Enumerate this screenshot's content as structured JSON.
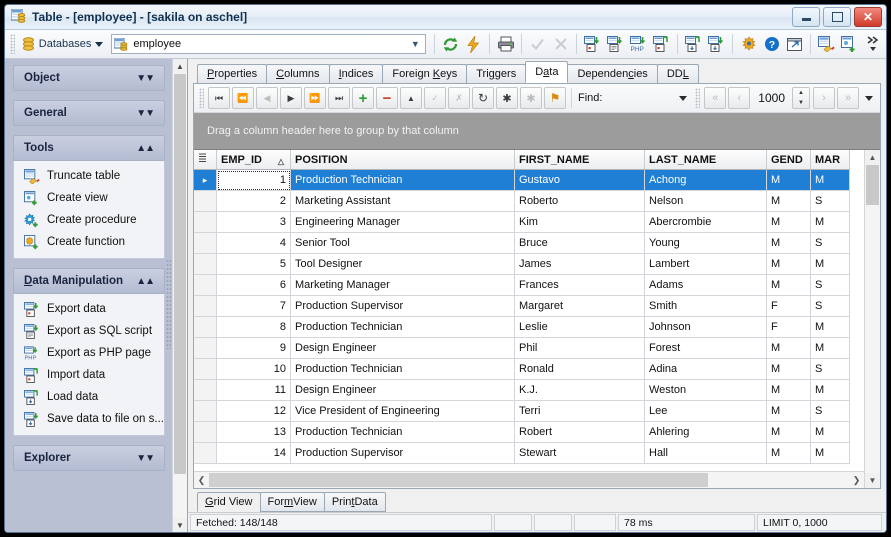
{
  "window": {
    "title": "Table - [employee] - [sakila on aschel]",
    "icon": "table-icon",
    "minimize_label": "Minimize",
    "maximize_label": "Maximize",
    "close_label": "✕"
  },
  "toolbar": {
    "databases_label": "Databases",
    "object_combo_value": "employee",
    "buttons": [
      {
        "name": "refresh-button",
        "icon": "refresh-icon"
      },
      {
        "name": "execute-button",
        "icon": "lightning-icon"
      },
      {
        "name": "print-button",
        "icon": "printer-icon"
      },
      {
        "name": "commit-button",
        "icon": "check-icon"
      },
      {
        "name": "rollback-button",
        "icon": "cross-icon"
      },
      {
        "name": "export-data-button",
        "icon": "export-data-icon"
      },
      {
        "name": "export-sql-button",
        "icon": "export-sql-icon"
      },
      {
        "name": "export-php-button",
        "icon": "export-php-icon"
      },
      {
        "name": "import-data-button",
        "icon": "import-data-icon"
      },
      {
        "name": "load-data-button",
        "icon": "load-data-icon"
      },
      {
        "name": "save-data-button",
        "icon": "save-data-icon"
      },
      {
        "name": "settings-button",
        "icon": "options-icon"
      },
      {
        "name": "help-button",
        "icon": "help-icon"
      },
      {
        "name": "open-external-button",
        "icon": "external-window-icon"
      },
      {
        "name": "truncate-table-button",
        "icon": "truncate-table-icon"
      },
      {
        "name": "create-view-button",
        "icon": "create-view-icon"
      },
      {
        "name": "overflow-button",
        "icon": "chevron-double-right-icon"
      }
    ]
  },
  "sidebar": {
    "sections": [
      {
        "title": "Object",
        "collapsed": true,
        "items": []
      },
      {
        "title": "General",
        "collapsed": true,
        "items": []
      },
      {
        "title": "Tools",
        "collapsed": false,
        "items": [
          {
            "label": "Truncate table",
            "icon": "truncate-table-icon"
          },
          {
            "label": "Create view",
            "icon": "create-view-icon"
          },
          {
            "label": "Create procedure",
            "icon": "create-procedure-icon"
          },
          {
            "label": "Create function",
            "icon": "create-function-icon"
          }
        ]
      },
      {
        "title": "Data Manipulation",
        "title_accel": "D",
        "collapsed": false,
        "items": [
          {
            "label": "Export data",
            "icon": "export-data-icon"
          },
          {
            "label": "Export as SQL script",
            "icon": "export-sql-icon"
          },
          {
            "label": "Export as PHP page",
            "icon": "export-php-icon"
          },
          {
            "label": "Import data",
            "icon": "import-data-icon"
          },
          {
            "label": "Load data",
            "icon": "load-data-icon"
          },
          {
            "label": "Save data to file on s...",
            "icon": "save-data-icon"
          }
        ]
      },
      {
        "title": "Explorer",
        "collapsed": true,
        "items": []
      }
    ]
  },
  "tabs": [
    {
      "label": "Properties",
      "accel": "P",
      "active": false
    },
    {
      "label": "Columns",
      "accel": "C",
      "active": false
    },
    {
      "label": "Indices",
      "accel": "I",
      "active": false
    },
    {
      "label": "Foreign Keys",
      "accel": "K",
      "active": false
    },
    {
      "label": "Triggers",
      "accel": "g",
      "active": false
    },
    {
      "label": "Data",
      "accel": "a",
      "active": true
    },
    {
      "label": "Dependencies",
      "accel": "c",
      "active": false
    },
    {
      "label": "DDL",
      "accel": "L",
      "active": false
    }
  ],
  "navbar": {
    "buttons": [
      {
        "name": "first-record-button",
        "icon": "first-icon",
        "glyph": "⏮",
        "disabled": false
      },
      {
        "name": "prior-page-button",
        "icon": "prior-page-icon",
        "glyph": "⏪",
        "disabled": true
      },
      {
        "name": "prior-record-button",
        "icon": "prior-icon",
        "glyph": "◀",
        "disabled": true
      },
      {
        "name": "next-record-button",
        "icon": "next-icon",
        "glyph": "▶",
        "disabled": false
      },
      {
        "name": "next-page-button",
        "icon": "next-page-icon",
        "glyph": "⏩",
        "disabled": false
      },
      {
        "name": "last-record-button",
        "icon": "last-icon",
        "glyph": "⏭",
        "disabled": false
      },
      {
        "name": "insert-record-button",
        "icon": "plus-icon",
        "glyph": "＋",
        "disabled": false,
        "color": "#2e9b34"
      },
      {
        "name": "delete-record-button",
        "icon": "minus-icon",
        "glyph": "−",
        "disabled": false,
        "color": "#cc3b28"
      },
      {
        "name": "edit-record-button",
        "icon": "triangle-up-icon",
        "glyph": "▲",
        "disabled": false
      },
      {
        "name": "post-edit-button",
        "icon": "check-icon",
        "glyph": "✓",
        "disabled": true
      },
      {
        "name": "cancel-edit-button",
        "icon": "cancel-icon",
        "glyph": "✗",
        "disabled": true
      },
      {
        "name": "refresh-data-button",
        "icon": "refresh-arrow-icon",
        "glyph": "↻",
        "disabled": false
      },
      {
        "name": "select-all-button",
        "icon": "asterisk-icon",
        "glyph": "✱",
        "disabled": false
      },
      {
        "name": "clear-selection-button",
        "icon": "asterisk-grey-icon",
        "glyph": "✱",
        "disabled": true
      },
      {
        "name": "filter-button",
        "icon": "filter-icon",
        "glyph": "⚑",
        "disabled": false,
        "color": "#d98a12"
      }
    ],
    "find_label": "Find:",
    "find_value": "",
    "record_limit": "1000",
    "pager_buttons": [
      {
        "name": "first-page-button",
        "icon": "double-left-icon",
        "glyph": "«",
        "disabled": true
      },
      {
        "name": "previous-page-button",
        "icon": "left-icon",
        "glyph": "‹",
        "disabled": true
      },
      {
        "name": "next-page-button2",
        "icon": "right-icon",
        "glyph": "›",
        "disabled": true
      },
      {
        "name": "last-page-button",
        "icon": "double-right-icon",
        "glyph": "»",
        "disabled": true
      }
    ]
  },
  "grid": {
    "group_panel_text": "Drag a column header here to group by that column",
    "columns": [
      {
        "key": "emp_id",
        "label": "EMP_ID",
        "sorted": true,
        "sort_dir": "asc",
        "align": "right"
      },
      {
        "key": "position",
        "label": "POSITION",
        "align": "left"
      },
      {
        "key": "first_name",
        "label": "FIRST_NAME",
        "align": "left"
      },
      {
        "key": "last_name",
        "label": "LAST_NAME",
        "align": "left"
      },
      {
        "key": "gender",
        "label": "GEND",
        "align": "left"
      },
      {
        "key": "marital",
        "label": "MAR",
        "align": "left"
      }
    ],
    "rows": [
      {
        "emp_id": "1",
        "position": "Production Technician",
        "first_name": "Gustavo",
        "last_name": "Achong",
        "gender": "M",
        "marital": "M",
        "selected": true
      },
      {
        "emp_id": "2",
        "position": "Marketing Assistant",
        "first_name": "Roberto",
        "last_name": "Nelson",
        "gender": "M",
        "marital": "S",
        "selected": false
      },
      {
        "emp_id": "3",
        "position": "Engineering Manager",
        "first_name": "Kim",
        "last_name": "Abercrombie",
        "gender": "M",
        "marital": "M",
        "selected": false
      },
      {
        "emp_id": "4",
        "position": "Senior Tool",
        "first_name": "Bruce",
        "last_name": "Young",
        "gender": "M",
        "marital": "S",
        "selected": false
      },
      {
        "emp_id": "5",
        "position": "Tool Designer",
        "first_name": "James",
        "last_name": "Lambert",
        "gender": "M",
        "marital": "M",
        "selected": false
      },
      {
        "emp_id": "6",
        "position": "Marketing Manager",
        "first_name": "Frances",
        "last_name": "Adams",
        "gender": "M",
        "marital": "S",
        "selected": false
      },
      {
        "emp_id": "7",
        "position": "Production Supervisor",
        "first_name": "Margaret",
        "last_name": "Smith",
        "gender": "F",
        "marital": "S",
        "selected": false
      },
      {
        "emp_id": "8",
        "position": "Production Technician",
        "first_name": "Leslie",
        "last_name": "Johnson",
        "gender": "F",
        "marital": "M",
        "selected": false
      },
      {
        "emp_id": "9",
        "position": "Design Engineer",
        "first_name": "Phil",
        "last_name": "Forest",
        "gender": "M",
        "marital": "M",
        "selected": false
      },
      {
        "emp_id": "10",
        "position": "Production Technician",
        "first_name": "Ronald",
        "last_name": "Adina",
        "gender": "M",
        "marital": "S",
        "selected": false
      },
      {
        "emp_id": "11",
        "position": "Design Engineer",
        "first_name": "K.J.",
        "last_name": "Weston",
        "gender": "M",
        "marital": "M",
        "selected": false
      },
      {
        "emp_id": "12",
        "position": "Vice President of Engineering",
        "first_name": "Terri",
        "last_name": "Lee",
        "gender": "M",
        "marital": "S",
        "selected": false
      },
      {
        "emp_id": "13",
        "position": "Production Technician",
        "first_name": "Robert",
        "last_name": "Ahlering",
        "gender": "M",
        "marital": "M",
        "selected": false
      },
      {
        "emp_id": "14",
        "position": "Production Supervisor",
        "first_name": "Stewart",
        "last_name": "Hall",
        "gender": "M",
        "marital": "M",
        "selected": false
      }
    ]
  },
  "view_tabs": [
    {
      "label": "Grid View",
      "accel": "G",
      "active": true
    },
    {
      "label": "Form View",
      "accel": "m",
      "active": false
    },
    {
      "label": "Print Data",
      "accel": "t",
      "active": false
    }
  ],
  "status": {
    "fetched": "Fetched: 148/148",
    "cell2": "",
    "cell3": "",
    "cell4": "",
    "elapsed": "78 ms",
    "limit": "LIMIT 0, 1000"
  }
}
